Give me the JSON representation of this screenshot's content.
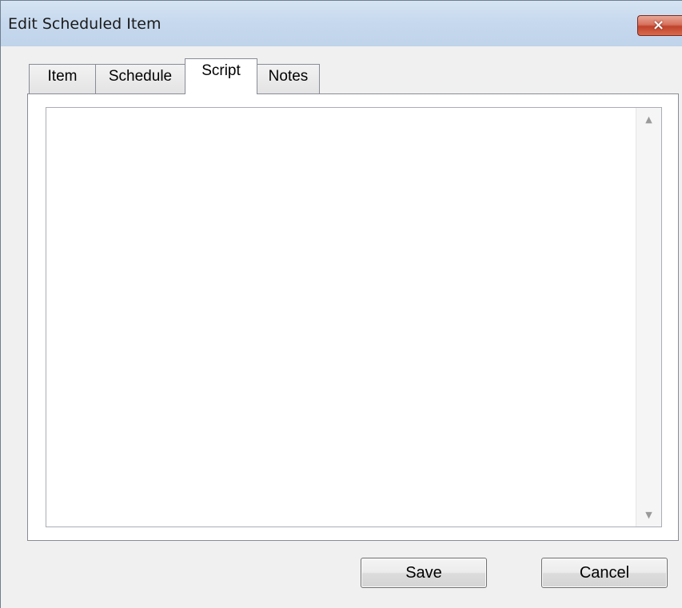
{
  "window": {
    "title": "Edit Scheduled Item",
    "close_glyph": "×",
    "close_icon": "close-icon"
  },
  "tabs": [
    {
      "label": "Item",
      "active": false
    },
    {
      "label": "Schedule",
      "active": false
    },
    {
      "label": "Script",
      "active": true
    },
    {
      "label": "Notes",
      "active": false
    }
  ],
  "script_panel": {
    "text": "",
    "scroll_up_glyph": "▲",
    "scroll_down_glyph": "▼"
  },
  "buttons": {
    "save_label": "Save",
    "cancel_label": "Cancel"
  },
  "colors": {
    "titlebar": "#c7d9ee",
    "close_button": "#c0432c",
    "dialog_background": "#f0f0f0"
  }
}
